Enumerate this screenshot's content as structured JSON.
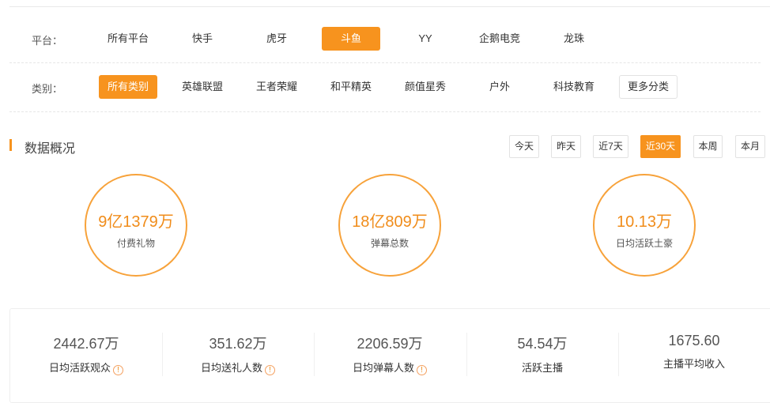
{
  "platform": {
    "label": "平台：",
    "options": [
      "所有平台",
      "快手",
      "虎牙",
      "斗鱼",
      "YY",
      "企鹅电竞",
      "龙珠"
    ],
    "selected": "斗鱼"
  },
  "category": {
    "label": "类别：",
    "options": [
      "所有类别",
      "英雄联盟",
      "王者荣耀",
      "和平精英",
      "颜值星秀",
      "户外",
      "科技教育",
      "更多分类"
    ],
    "selected": "所有类别"
  },
  "overview": {
    "title": "数据概况",
    "time_buttons": [
      "今天",
      "昨天",
      "近7天",
      "近30天",
      "本周",
      "本月"
    ],
    "selected_time": "近30天",
    "circles": [
      {
        "value": "9亿1379万",
        "label": "付费礼物"
      },
      {
        "value": "18亿809万",
        "label": "弹幕总数"
      },
      {
        "value": "10.13万",
        "label": "日均活跃土豪"
      }
    ],
    "stats": [
      {
        "value": "2442.67万",
        "label": "日均活跃观众",
        "info": "!"
      },
      {
        "value": "351.62万",
        "label": "日均送礼人数",
        "info": "!"
      },
      {
        "value": "2206.59万",
        "label": "日均弹幕人数",
        "info": "!"
      },
      {
        "value": "54.54万",
        "label": "活跃主播"
      },
      {
        "value": "1675.60",
        "label": "主播平均收入"
      }
    ]
  },
  "colors": {
    "accent": "#f7931e"
  }
}
